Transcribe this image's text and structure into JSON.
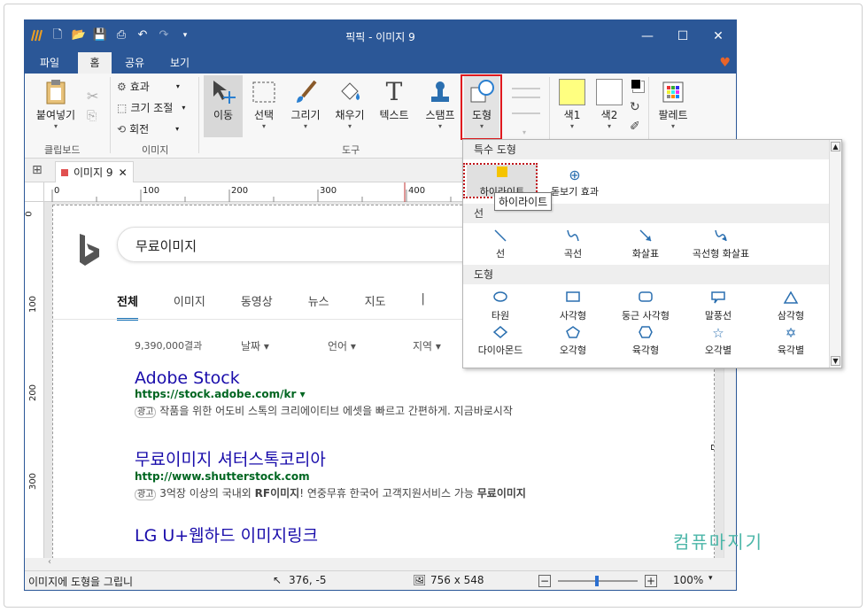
{
  "app": {
    "title": "픽픽 - 이미지 9",
    "qat_icons": [
      "app-logo-icon",
      "new-icon",
      "open-icon",
      "save-icon",
      "print-icon",
      "undo-icon",
      "redo-icon",
      "customize-icon"
    ],
    "window_controls": [
      "minimize-icon",
      "maximize-icon",
      "close-icon"
    ]
  },
  "menu_tabs": [
    {
      "label": "파일"
    },
    {
      "label": "홈"
    },
    {
      "label": "공유"
    },
    {
      "label": "보기"
    }
  ],
  "ribbon": {
    "clipboard": {
      "paste": "붙여넣기",
      "group": "클립보드"
    },
    "image": {
      "effects": "효과",
      "resize": "크기 조절",
      "rotate": "회전",
      "group": "이미지"
    },
    "tools": {
      "move": "이동",
      "select": "선택",
      "draw": "그리기",
      "fill": "채우기",
      "text": "텍스트",
      "stamp": "스탬프",
      "shape": "도형",
      "group": "도구"
    },
    "colors": {
      "color1": "색1",
      "color2": "색2",
      "palette": "팔레트",
      "color1_value": "#ffff80",
      "color2_value": "#ffffff"
    }
  },
  "doc_tab": {
    "label": "이미지 9"
  },
  "ruler_h": [
    "0",
    "100",
    "200",
    "300",
    "400"
  ],
  "ruler_v": [
    "0",
    "100",
    "200",
    "300"
  ],
  "shape_dropdown": {
    "sections": {
      "special": "특수 도형",
      "line": "선",
      "shape": "도형"
    },
    "special_items": [
      "하이라이트",
      "돋보기 효과"
    ],
    "line_items": [
      "선",
      "곡선",
      "화살표",
      "곡선형 화살표"
    ],
    "shape_items_row1": [
      "타원",
      "사각형",
      "둥근 사각형",
      "말풍선",
      "삼각형"
    ],
    "shape_items_row2": [
      "다이아몬드",
      "오각형",
      "육각형",
      "오각별",
      "육각별"
    ]
  },
  "tooltip": "하이라이트",
  "captured": {
    "search_query": "무료이미지",
    "tabs": [
      "전체",
      "이미지",
      "동영상",
      "뉴스",
      "지도"
    ],
    "result_count": "9,390,000결과",
    "filters": [
      "날짜",
      "언어",
      "지역"
    ],
    "results": [
      {
        "title": "Adobe Stock",
        "url": "https://stock.adobe.com/kr",
        "badge": "광고",
        "desc": "작품을 위한 어도비 스톡의 크리에이티브 에셋을 빠르고 간편하게. 지금바로시작"
      },
      {
        "title": "무료이미지 셔터스톡코리아",
        "url": "http://www.shutterstock.com",
        "badge": "광고",
        "desc_pre": "3억장 이상의 국내외 ",
        "desc_bold": "RF이미지",
        "desc_mid": "! 연중무휴 한국어 고객지원서비스 가능 ",
        "desc_bold2": "무료이미지"
      },
      {
        "title": "LG U+웹하드 이미지링크"
      }
    ]
  },
  "status": {
    "message": "이미지에 도형을 그립니",
    "cursor": "376, -5",
    "size": "756 x 548",
    "zoom": "100%"
  },
  "watermark": "컴퓨마지기"
}
